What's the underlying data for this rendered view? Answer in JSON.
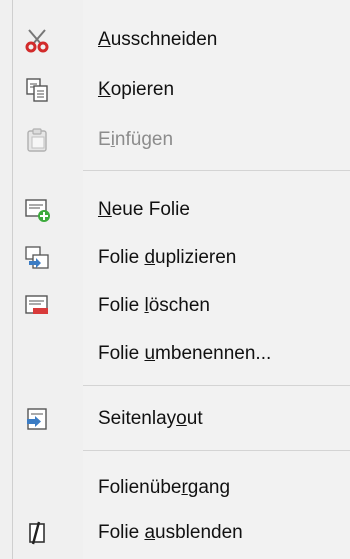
{
  "menu": {
    "items": [
      {
        "label": "Ausschneiden",
        "mnemonic_index": 0,
        "icon": "scissors-icon",
        "enabled": true
      },
      {
        "label": "Kopieren",
        "mnemonic_index": 0,
        "icon": "copy-icon",
        "enabled": true
      },
      {
        "label": "Einfügen",
        "mnemonic_index": 1,
        "icon": "paste-icon",
        "enabled": false
      },
      {
        "label": "Neue Folie",
        "mnemonic_index": 0,
        "icon": "new-slide-icon",
        "enabled": true
      },
      {
        "label": "Folie duplizieren",
        "mnemonic_index": 6,
        "icon": "duplicate-slide-icon",
        "enabled": true
      },
      {
        "label": "Folie löschen",
        "mnemonic_index": 6,
        "icon": "delete-slide-icon",
        "enabled": true
      },
      {
        "label": "Folie umbenennen...",
        "mnemonic_index": 6,
        "icon": "",
        "enabled": true
      },
      {
        "label": "Seitenlayout",
        "mnemonic_index": 9,
        "icon": "page-layout-icon",
        "enabled": true
      },
      {
        "label": "Folienübergang",
        "mnemonic_index": 9,
        "icon": "",
        "enabled": true
      },
      {
        "label": "Folie ausblenden",
        "mnemonic_index": 6,
        "icon": "hide-slide-icon",
        "enabled": true
      }
    ]
  },
  "colors": {
    "scissors_red": "#d22b2b",
    "add_green": "#3caa3c",
    "delete_red": "#d83a3a",
    "icon_blue": "#3b7cc4",
    "disabled_text": "#8c8c8c"
  }
}
